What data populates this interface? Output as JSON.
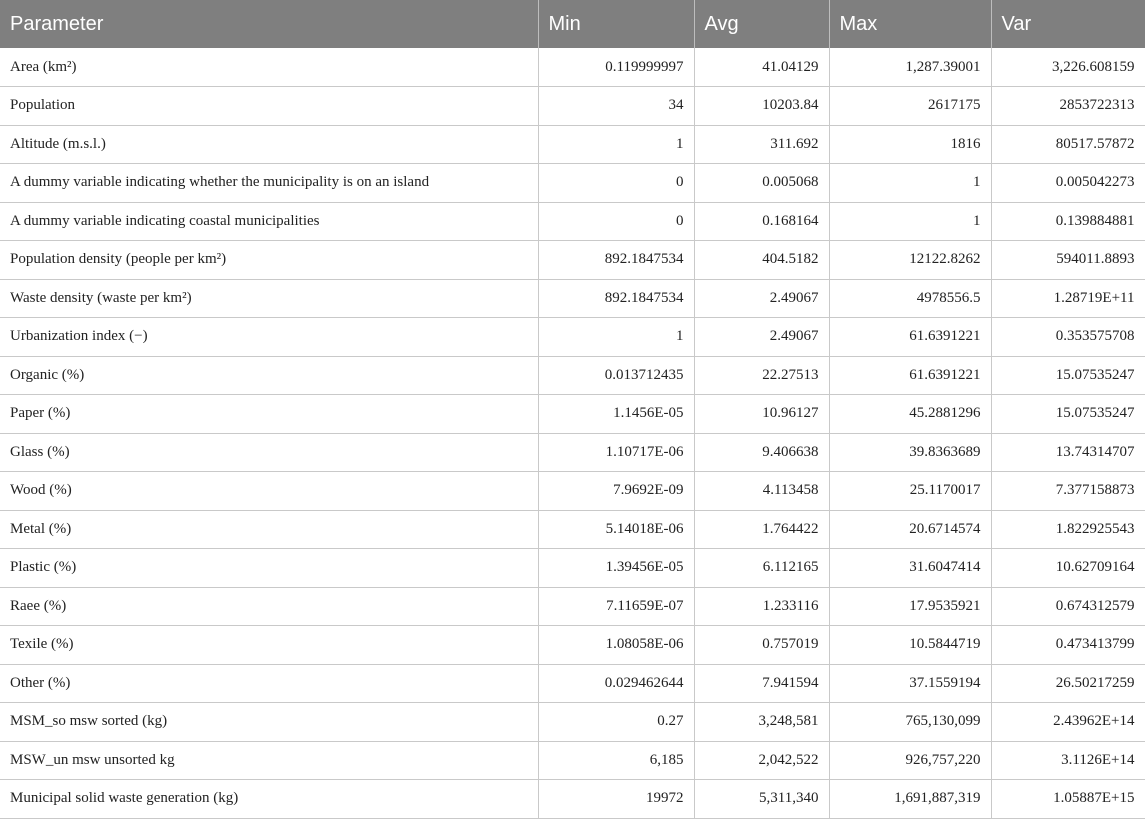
{
  "table": {
    "headers": [
      "Parameter",
      "Min",
      "Avg",
      "Max",
      "Var"
    ],
    "rows": [
      [
        "Area (km²)",
        "0.119999997",
        "41.04129",
        "1,287.39001",
        "3,226.608159"
      ],
      [
        "Population",
        "34",
        "10203.84",
        "2617175",
        "2853722313"
      ],
      [
        "Altitude (m.s.l.)",
        "1",
        "311.692",
        "1816",
        "80517.57872"
      ],
      [
        "A dummy variable indicating whether the municipality is on an island",
        "0",
        "0.005068",
        "1",
        "0.005042273"
      ],
      [
        "A dummy variable indicating coastal municipalities",
        "0",
        "0.168164",
        "1",
        "0.139884881"
      ],
      [
        "Population density (people per km²)",
        "892.1847534",
        "404.5182",
        "12122.8262",
        "594011.8893"
      ],
      [
        "Waste density (waste per km²)",
        "892.1847534",
        "2.49067",
        "4978556.5",
        "1.28719E+11"
      ],
      [
        "Urbanization index (−)",
        "1",
        "2.49067",
        "61.6391221",
        "0.353575708"
      ],
      [
        "Organic (%)",
        "0.013712435",
        "22.27513",
        "61.6391221",
        "15.07535247"
      ],
      [
        "Paper (%)",
        "1.1456E-05",
        "10.96127",
        "45.2881296",
        "15.07535247"
      ],
      [
        "Glass (%)",
        "1.10717E-06",
        "9.406638",
        "39.8363689",
        "13.74314707"
      ],
      [
        "Wood (%)",
        "7.9692E-09",
        "4.113458",
        "25.1170017",
        "7.377158873"
      ],
      [
        "Metal (%)",
        "5.14018E-06",
        "1.764422",
        "20.6714574",
        "1.822925543"
      ],
      [
        "Plastic (%)",
        "1.39456E-05",
        "6.112165",
        "31.6047414",
        "10.62709164"
      ],
      [
        "Raee (%)",
        "7.11659E-07",
        "1.233116",
        "17.9535921",
        "0.674312579"
      ],
      [
        "Texile (%)",
        "1.08058E-06",
        "0.757019",
        "10.5844719",
        "0.473413799"
      ],
      [
        "Other (%)",
        "0.029462644",
        "7.941594",
        "37.1559194",
        "26.50217259"
      ],
      [
        "MSM_so msw sorted (kg)",
        "0.27",
        "3,248,581",
        "765,130,099",
        "2.43962E+14"
      ],
      [
        "MSW_un msw unsorted kg",
        "6,185",
        "2,042,522",
        "926,757,220",
        "3.1126E+14"
      ],
      [
        "Municipal solid waste generation (kg)",
        "19972",
        "5,311,340",
        "1,691,887,319",
        "1.05887E+15"
      ]
    ]
  }
}
